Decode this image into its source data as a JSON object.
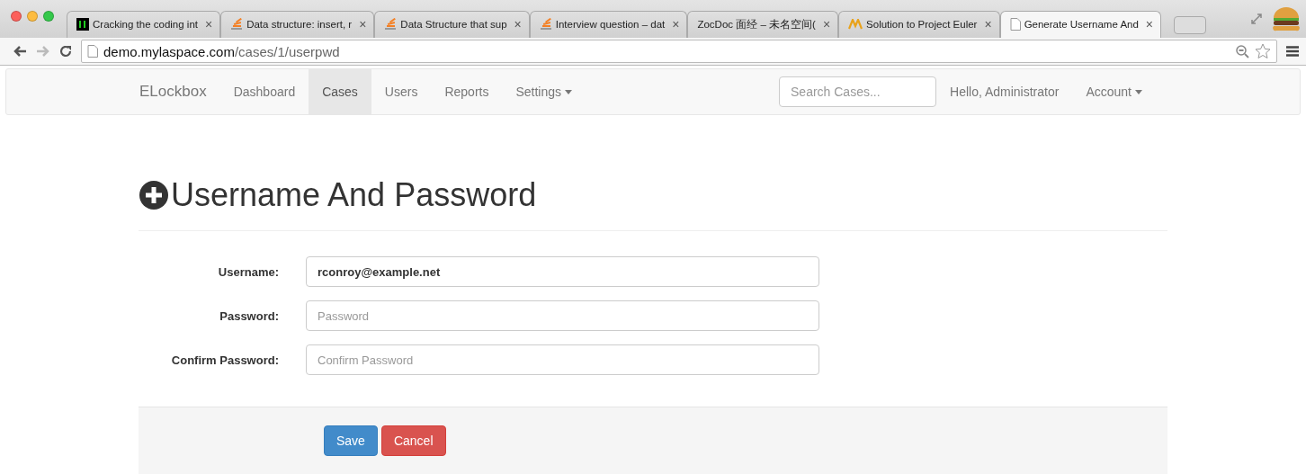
{
  "browser": {
    "tabs": [
      {
        "title": "Cracking the coding int",
        "kind": "terminal",
        "close": "×",
        "selected": false
      },
      {
        "title": "Data structure: insert, r",
        "kind": "stack",
        "close": "×",
        "selected": false
      },
      {
        "title": "Data Structure that sup",
        "kind": "stack",
        "close": "×",
        "selected": false
      },
      {
        "title": "Interview question – dat",
        "kind": "stack",
        "close": "×",
        "selected": false
      },
      {
        "title": "ZocDoc 面经 – 未名空间(",
        "kind": "plain",
        "close": "×",
        "selected": false
      },
      {
        "title": "Solution to Project Euler",
        "kind": "m",
        "close": "×",
        "selected": false
      },
      {
        "title": "Generate Username And",
        "kind": "page",
        "close": "×",
        "selected": true
      }
    ],
    "url": {
      "host": "demo.mylaspace.com",
      "path": "/cases/1/userpwd"
    }
  },
  "navbar": {
    "brand": "ELockbox",
    "items": [
      {
        "label": "Dashboard",
        "selected": false,
        "dropdown": false
      },
      {
        "label": "Cases",
        "selected": true,
        "dropdown": false
      },
      {
        "label": "Users",
        "selected": false,
        "dropdown": false
      },
      {
        "label": "Reports",
        "selected": false,
        "dropdown": false
      },
      {
        "label": "Settings",
        "selected": false,
        "dropdown": true
      }
    ],
    "search": {
      "placeholder": "Search Cases..."
    },
    "greeting": "Hello, Administrator",
    "account": "Account"
  },
  "heading": "Username And Password",
  "form": {
    "fields": [
      {
        "label": "Username:",
        "value": "rconroy@example.net"
      },
      {
        "label": "Password:",
        "placeholder": "Password"
      },
      {
        "label": "Confirm Password:",
        "placeholder": "Confirm Password"
      }
    ],
    "buttons": [
      {
        "label": "Save",
        "kind": "primary"
      },
      {
        "label": "Cancel",
        "kind": "danger"
      }
    ]
  }
}
